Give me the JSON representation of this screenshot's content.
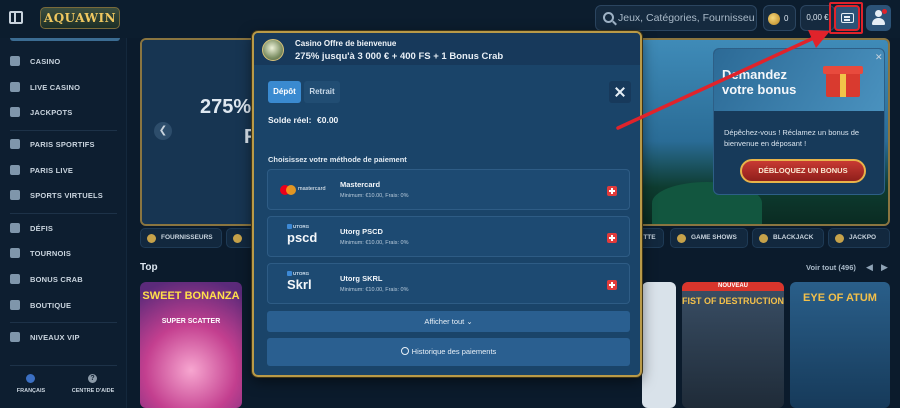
{
  "header": {
    "logo": "AQUAWIN",
    "search_placeholder": "Jeux, Catégories, Fournisseurs",
    "coins": "0",
    "balance": "0,00 €"
  },
  "sidebar": {
    "items": [
      {
        "label": "CASINO",
        "icon": "casino-icon"
      },
      {
        "label": "LIVE CASINO",
        "icon": "live-casino-icon"
      },
      {
        "label": "JACKPOTS",
        "icon": "jackpots-icon"
      },
      {
        "label": "PARIS SPORTIFS",
        "icon": "sports-betting-icon"
      },
      {
        "label": "PARIS LIVE",
        "icon": "live-betting-icon"
      },
      {
        "label": "SPORTS VIRTUELS",
        "icon": "virtual-sports-icon"
      },
      {
        "label": "DÉFIS",
        "icon": "challenges-icon"
      },
      {
        "label": "TOURNOIS",
        "icon": "tournaments-icon"
      },
      {
        "label": "BONUS CRAB",
        "icon": "bonus-crab-icon"
      },
      {
        "label": "BOUTIQUE",
        "icon": "shop-icon"
      },
      {
        "label": "NIVEAUX VIP",
        "icon": "vip-icon"
      }
    ],
    "language": "FRANÇAIS",
    "help": "CENTRE D'AIDE"
  },
  "hero": {
    "text_line1": "275%",
    "text_line2": "F"
  },
  "promo": {
    "title": "Demandez votre bonus",
    "text": "Dépêchez-vous ! Réclamez un bonus de bienvenue en déposant !",
    "cta": "DÉBLOQUEZ UN BONUS"
  },
  "categories": {
    "chips": [
      "FOURNISSEURS",
      "ETTE",
      "GAME SHOWS",
      "BLACKJACK",
      "JACKPO"
    ]
  },
  "games": {
    "section_title": "Top",
    "view_all": "Voir tout (496)",
    "tiles": [
      {
        "title": "SWEET BONANZA",
        "subtitle": "SUPER SCATTER"
      },
      {
        "title": "NOUVEAU",
        "subtitle": "FIST OF DESTRUCTION"
      },
      {
        "title": "EYE OF ATUM",
        "subtitle": ""
      }
    ]
  },
  "modal": {
    "offer_title": "Casino Offre de bienvenue",
    "offer_subtitle": "275% jusqu'à 3 000 € + 400 FS + 1 Bonus Crab",
    "tabs": [
      "Dépôt",
      "Retrait"
    ],
    "balance_label": "Solde réel:",
    "balance_value": "€0.00",
    "method_heading": "Choisissez votre méthode de paiement",
    "methods": [
      {
        "name": "Mastercard",
        "limits": "Minimum: €10.00, Frais: 0%",
        "logo_text": "mastercard"
      },
      {
        "name": "Utorg PSCD",
        "limits": "Minimum: €10.00, Frais: 0%",
        "logo_top": "UTORG",
        "logo_text": "pscd"
      },
      {
        "name": "Utorg SKRL",
        "limits": "Minimum: €10.00, Frais: 0%",
        "logo_top": "UTORG",
        "logo_text": "Skrl"
      }
    ],
    "show_all": "Afficher tout",
    "history": "Historique des paiements"
  }
}
